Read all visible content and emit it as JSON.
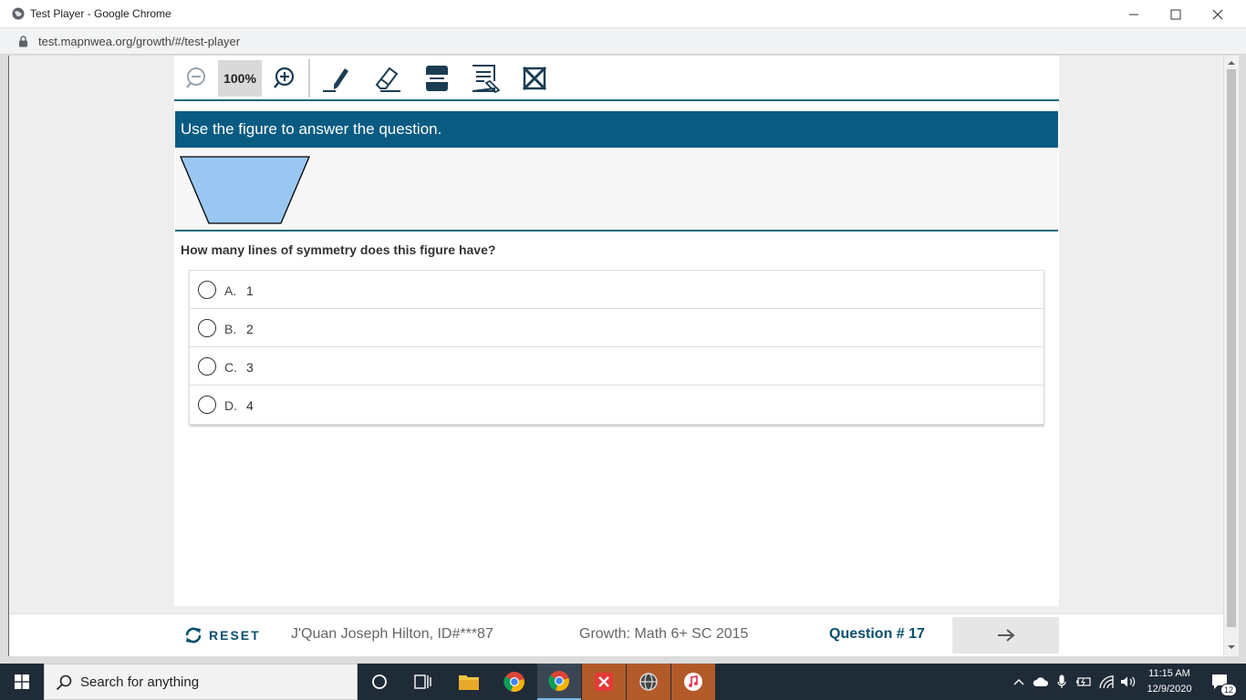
{
  "window": {
    "title": "Test Player - Google Chrome",
    "url": "test.mapnwea.org/growth/#/test-player"
  },
  "toolbar": {
    "zoom_level": "100%",
    "tools": [
      "zoom-out-icon",
      "zoom-in-icon",
      "highlighter-icon",
      "eraser-icon",
      "line-reader-icon",
      "notepad-icon",
      "answer-eliminator-icon"
    ]
  },
  "stimulus": {
    "instruction": "Use the figure to answer the question.",
    "figure_fill": "#99c7f2"
  },
  "question": {
    "prompt": "How many lines of symmetry does this figure have?",
    "choices": [
      {
        "letter": "A.",
        "value": "1"
      },
      {
        "letter": "B.",
        "value": "2"
      },
      {
        "letter": "C.",
        "value": "3"
      },
      {
        "letter": "D.",
        "value": "4"
      }
    ]
  },
  "footer": {
    "reset_label": "RESET",
    "student": "J'Quan Joseph Hilton, ID#***87",
    "test_name": "Growth: Math 6+ SC 2015",
    "question_number": "Question # 17"
  },
  "taskbar": {
    "search_placeholder": "Search for anything",
    "time": "11:15 AM",
    "date": "12/9/2020",
    "notification_count": "12"
  },
  "colors": {
    "header_blue": "#0a5b82",
    "accent_teal": "#0d6b7a",
    "taskbar": "#202b38"
  }
}
